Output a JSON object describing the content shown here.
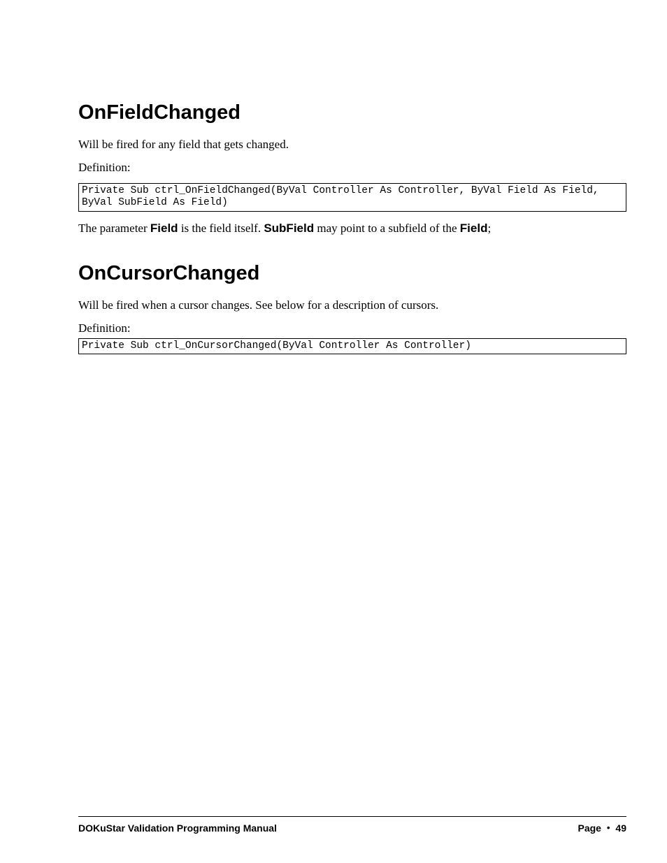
{
  "section1": {
    "heading": "OnFieldChanged",
    "p1": "Will be fired for any field that gets changed.",
    "p2": "Definition:",
    "code": "Private Sub ctrl_OnFieldChanged(ByVal Controller As Controller, ByVal Field As Field, ByVal SubField As Field)",
    "param_pre": "The parameter ",
    "param_b1": "Field",
    "param_mid1": " is the field itself. ",
    "param_b2": "SubField",
    "param_mid2": " may point to a subfield of the ",
    "param_b3": "Field",
    "param_end": ";"
  },
  "section2": {
    "heading": "OnCursorChanged",
    "p1": "Will be fired when a cursor changes. See below for a description of cursors.",
    "p2": "Definition:",
    "code": "Private Sub ctrl_OnCursorChanged(ByVal Controller As Controller)"
  },
  "footer": {
    "left": "DOKuStar Validation Programming Manual",
    "right_label": "Page",
    "right_num": "49"
  }
}
